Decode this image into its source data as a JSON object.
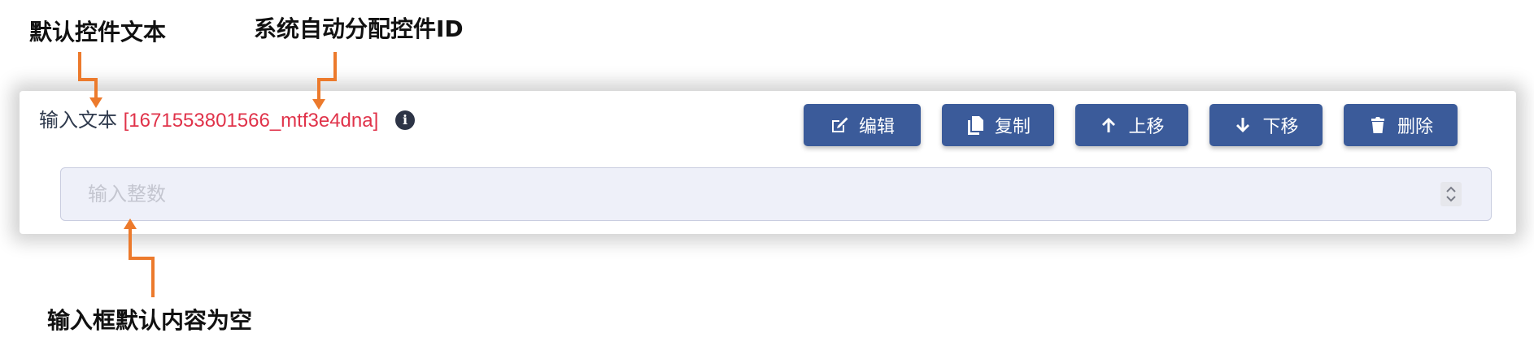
{
  "annotations": {
    "default_text": "默认控件文本",
    "auto_id": "系统自动分配控件ID",
    "empty_input": "输入框默认内容为空"
  },
  "field": {
    "label": "输入文本",
    "id_text": "[1671553801566_mtf3e4dna]",
    "info_icon": "i",
    "placeholder": "输入整数",
    "value": ""
  },
  "toolbar": {
    "edit_label": "编辑",
    "copy_label": "复制",
    "move_up_label": "上移",
    "move_down_label": "下移",
    "delete_label": "删除"
  },
  "colors": {
    "button_bg": "#3b5b9a",
    "id_text": "#e0334a",
    "arrow": "#ec7a2c",
    "input_bg": "#eef0f9"
  },
  "icons": [
    "edit-icon",
    "copy-icon",
    "arrow-up-icon",
    "arrow-down-icon",
    "trash-icon",
    "info-icon",
    "stepper-icon"
  ]
}
